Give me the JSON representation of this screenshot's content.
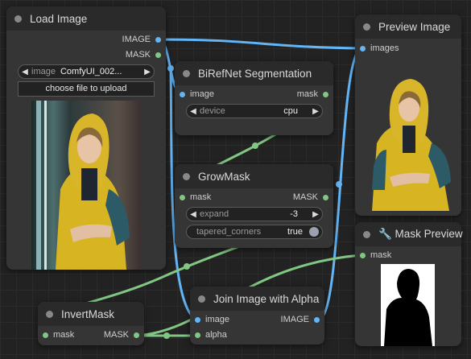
{
  "nodes": {
    "load_image": {
      "title": "Load Image",
      "outputs": [
        "IMAGE",
        "MASK"
      ],
      "image_widget": {
        "label": "image",
        "value": "ComfyUI_002..."
      },
      "upload_label": "choose file to upload"
    },
    "birefnet": {
      "title": "BiRefNet Segmentation",
      "input": "image",
      "output": "mask",
      "device_widget": {
        "label": "device",
        "value": "cpu"
      }
    },
    "grow_mask": {
      "title": "GrowMask",
      "input": "mask",
      "output": "MASK",
      "expand_widget": {
        "label": "expand",
        "value": "-3"
      },
      "tapered_widget": {
        "label": "tapered_corners",
        "value": "true"
      }
    },
    "preview_image": {
      "title": "Preview Image",
      "input": "images"
    },
    "mask_preview": {
      "title": "🔧 Mask Preview",
      "input": "mask"
    },
    "invert_mask": {
      "title": "InvertMask",
      "input": "mask",
      "output": "MASK"
    },
    "join_image": {
      "title": "Join Image with Alpha",
      "inputs": [
        "image",
        "alpha"
      ],
      "output": "IMAGE"
    }
  },
  "colors": {
    "image_wire": "#64b5f6",
    "mask_wire": "#81c784",
    "node_bg": "#353535",
    "header_bg": "#2a2a2a",
    "canvas_bg": "#222222"
  }
}
